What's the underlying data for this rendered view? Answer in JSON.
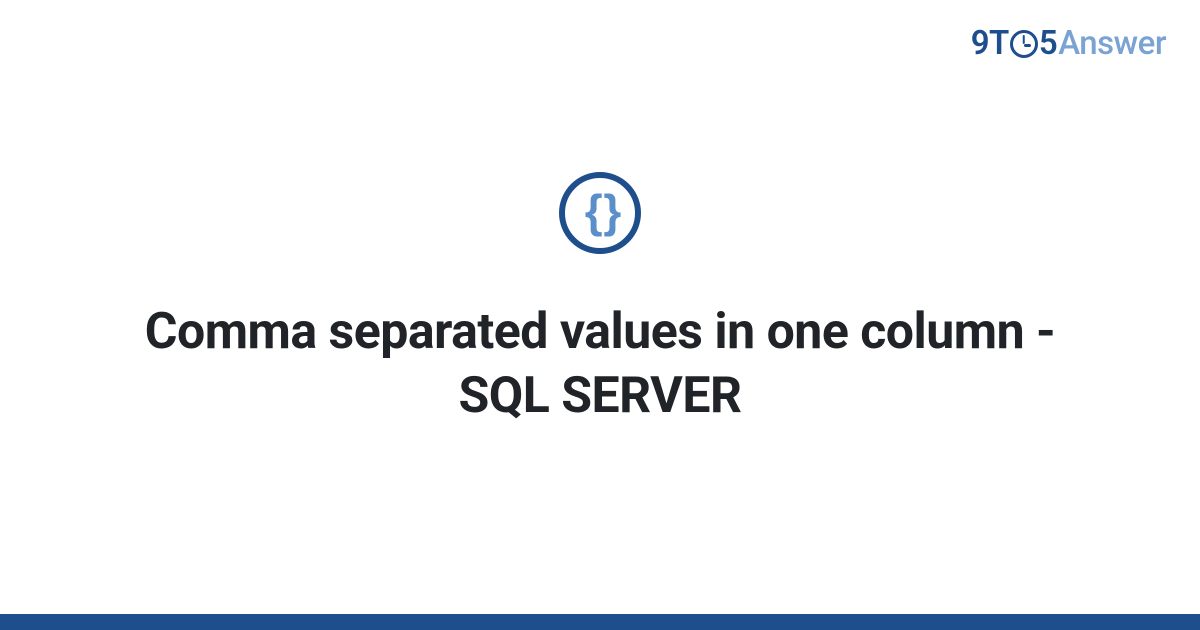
{
  "logo": {
    "part1": "9T",
    "part2": "5",
    "part3": "Answer"
  },
  "icon": {
    "glyph": "{ }"
  },
  "title": "Comma separated values in one column - SQL SERVER"
}
